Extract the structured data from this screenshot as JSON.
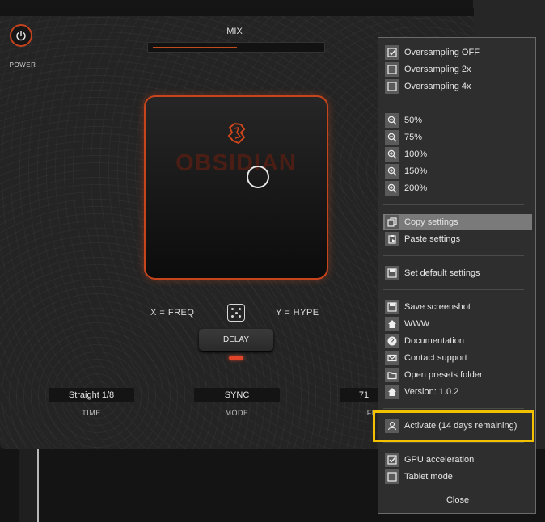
{
  "plugin": {
    "power_label": "POWER",
    "mix_label": "MIX",
    "mix_value": 0.5,
    "logo_text": "OBSIDIAN",
    "x_assign": "X  =  FREQ",
    "y_assign": "Y  =  HYPE",
    "delay_label": "DELAY",
    "time_value": "Straight 1/8",
    "time_label": "TIME",
    "mode_value": "SYNC",
    "mode_label": "MODE",
    "fe_value": "71",
    "fe_label": "FE",
    "accent_color": "#c6451d"
  },
  "menu": {
    "items": [
      {
        "icon": "checkbox-checked-icon",
        "label": "Oversampling OFF"
      },
      {
        "icon": "checkbox-icon",
        "label": "Oversampling 2x"
      },
      {
        "icon": "checkbox-icon",
        "label": "Oversampling 4x"
      },
      {
        "icon": "zoom-out-icon",
        "label": "50%"
      },
      {
        "icon": "zoom-out-icon",
        "label": "75%"
      },
      {
        "icon": "zoom-in-icon",
        "label": "100%"
      },
      {
        "icon": "zoom-in-icon",
        "label": "150%"
      },
      {
        "icon": "zoom-in-icon",
        "label": "200%"
      },
      {
        "icon": "copy-icon",
        "label": "Copy settings"
      },
      {
        "icon": "paste-icon",
        "label": "Paste settings"
      },
      {
        "icon": "save-icon",
        "label": "Set default settings"
      },
      {
        "icon": "save-icon",
        "label": "Save screenshot"
      },
      {
        "icon": "home-icon",
        "label": "WWW"
      },
      {
        "icon": "help-icon",
        "label": "Documentation"
      },
      {
        "icon": "mail-icon",
        "label": "Contact support"
      },
      {
        "icon": "folder-icon",
        "label": "Open presets folder"
      },
      {
        "icon": "home-icon",
        "label": "Version: 1.0.2"
      },
      {
        "icon": "user-icon",
        "label": "Activate (14 days remaining)"
      },
      {
        "icon": "checkbox-checked-icon",
        "label": "GPU acceleration"
      },
      {
        "icon": "checkbox-icon",
        "label": "Tablet mode"
      }
    ],
    "close_label": "Close",
    "highlight_color": "#f2c100"
  }
}
